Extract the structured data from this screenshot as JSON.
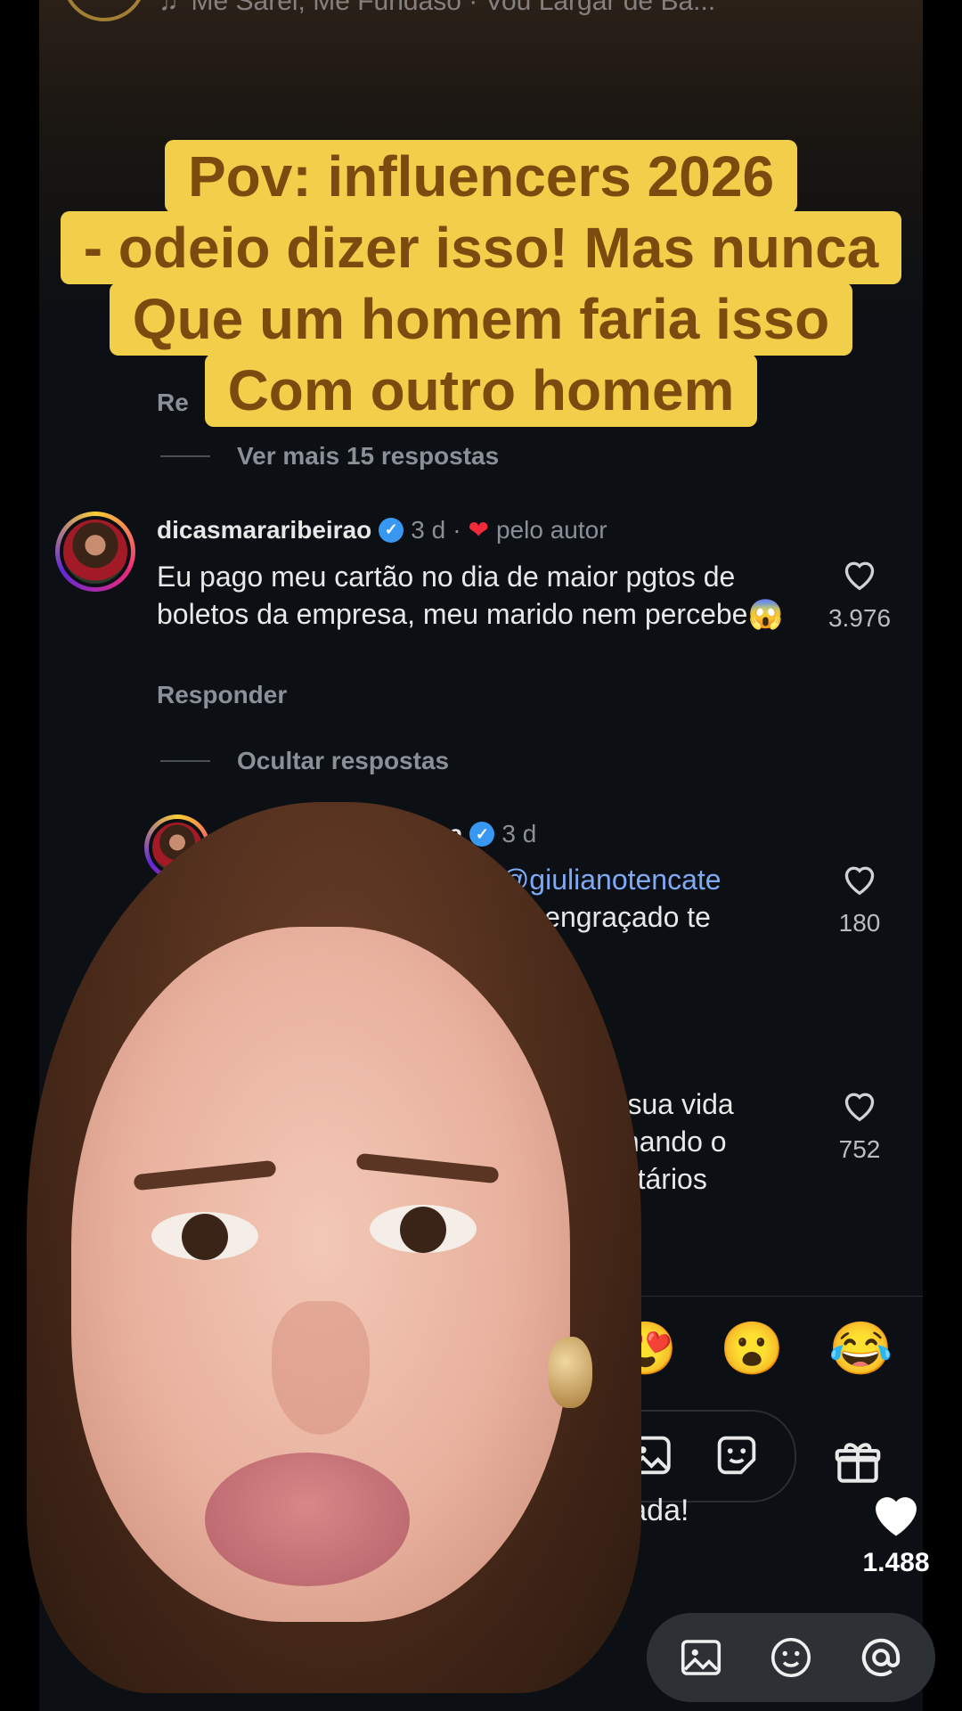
{
  "music": {
    "text": "Me Sarei, Me Fundaso · Vou Largar de Ba..."
  },
  "caption": {
    "lines": [
      "Pov: influencers 2026",
      "- odeio dizer isso! Mas nunca",
      "Que um homem faria isso",
      "Com outro homem"
    ]
  },
  "thread": {
    "partial_reply_label": "Re",
    "more_replies": "Ver mais 15 respostas",
    "hide_replies": "Ocultar respostas"
  },
  "comments": [
    {
      "user": "dicasmararibeirao",
      "time": "3 d",
      "author_badge": "pelo autor",
      "text": "Eu pago meu cartão no dia de maior pgtos de boletos da empresa, meu marido nem percebe😱",
      "reply": "Responder",
      "likes": "3.976"
    },
    {
      "user": "...etaa",
      "time": "3 d",
      "text_line1": "...rao @giulianotencate",
      "text_line2": "...do engraçado te",
      "likes": "180"
    },
    {
      "text_line1": "da sua vida",
      "text_line2": "ionando o",
      "text_line3": "entários",
      "likes": "752"
    }
  ],
  "reactions": [
    "😍",
    "😮",
    "😂"
  ],
  "input": {
    "placeholder_tail": "e nada!"
  },
  "video_likes": "1.488",
  "colors": {
    "caption_bg": "#f2cf4a",
    "caption_text": "#7a4a0f",
    "verified": "#3897f0",
    "heart": "#ef2a3b"
  }
}
